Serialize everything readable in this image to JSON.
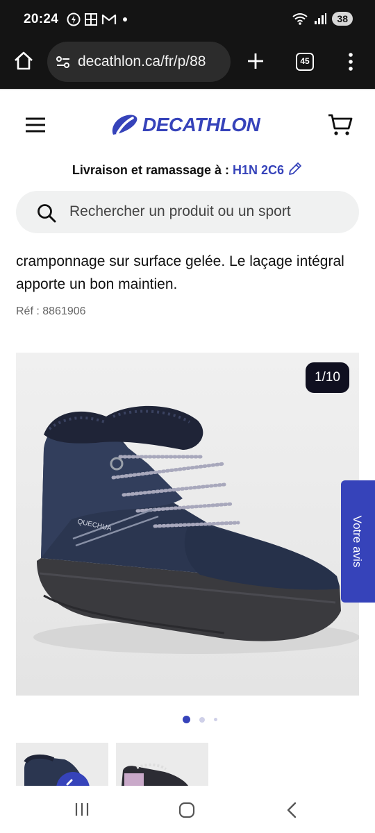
{
  "status_bar": {
    "time": "20:24",
    "battery": "38",
    "icons": [
      "speed-icon",
      "uniqlo-icon",
      "gmail-icon",
      "dot-icon",
      "wifi-icon",
      "signal-icon"
    ]
  },
  "browser": {
    "url": "decathlon.ca/fr/p/88",
    "tab_count": "45"
  },
  "header": {
    "brand": "DECATHLON",
    "brand_color": "#3643ba"
  },
  "delivery": {
    "label": "Livraison et ramassage à :",
    "postal_code": "H1N 2C6"
  },
  "search": {
    "placeholder": "Rechercher un produit ou un sport"
  },
  "product": {
    "description": "cramponnage sur surface gelée. Le laçage intégral apporte un bon maintien.",
    "ref": "Réf : 8861906",
    "image_counter": "1/10",
    "shoe_brand_text": "QUECHUA"
  },
  "feedback": {
    "label": "Votre avis"
  },
  "carousel": {
    "dots": 3,
    "active": 0
  }
}
